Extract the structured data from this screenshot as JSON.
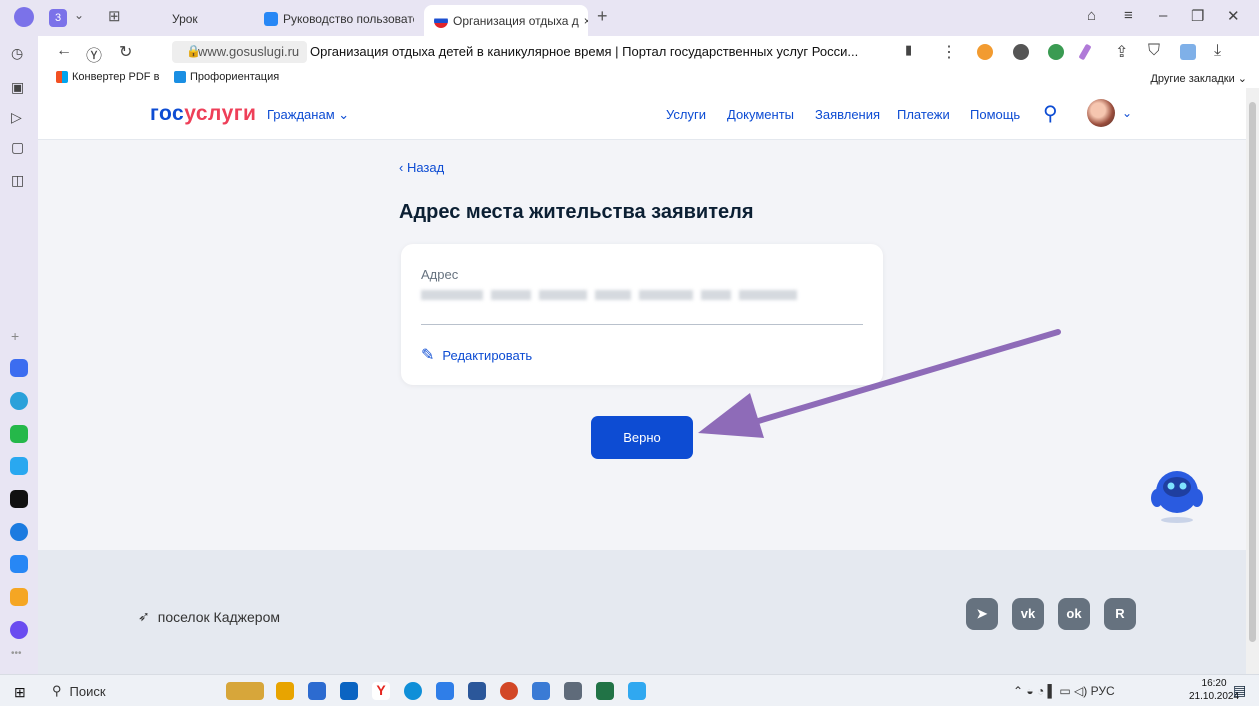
{
  "browser": {
    "tab_count": "3",
    "tabs": [
      {
        "label": "Урок"
      },
      {
        "label": "Руководство пользовате"
      },
      {
        "label": "Организация отдыха д",
        "close": "×"
      }
    ],
    "new_tab": "+",
    "address": {
      "domain": "www.gosuslugi.ru",
      "page_title": "Организация отдыха детей в каникулярное время | Портал государственных услуг Росси..."
    },
    "bookmarks": [
      {
        "label": "Конвертер PDF в"
      },
      {
        "label": "Профориентация"
      }
    ],
    "other_bookmarks": "Другие закладки ⌄"
  },
  "site": {
    "logo": {
      "part1": "гос",
      "part2": "услуги"
    },
    "citizens_menu": "Гражданам ⌄",
    "nav": [
      "Услуги",
      "Документы",
      "Заявления",
      "Платежи",
      "Помощь"
    ],
    "avatar_chevron": "⌄"
  },
  "page": {
    "back": "‹ Назад",
    "title": "Адрес места жительства заявителя",
    "address_label": "Адрес",
    "edit_label": "Редактировать",
    "confirm_button": "Верно"
  },
  "footer": {
    "location": "поселок Каджером",
    "social": [
      "telegram",
      "vk",
      "odnoklassniki",
      "rutube"
    ]
  },
  "taskbar": {
    "search": "Поиск",
    "lang": "РУС",
    "time": "16:20",
    "date": "21.10.2024"
  },
  "colors": {
    "brand_blue": "#0d4cd3",
    "brand_red": "#ee3f58",
    "annotation_arrow": "#8e6bb8"
  }
}
